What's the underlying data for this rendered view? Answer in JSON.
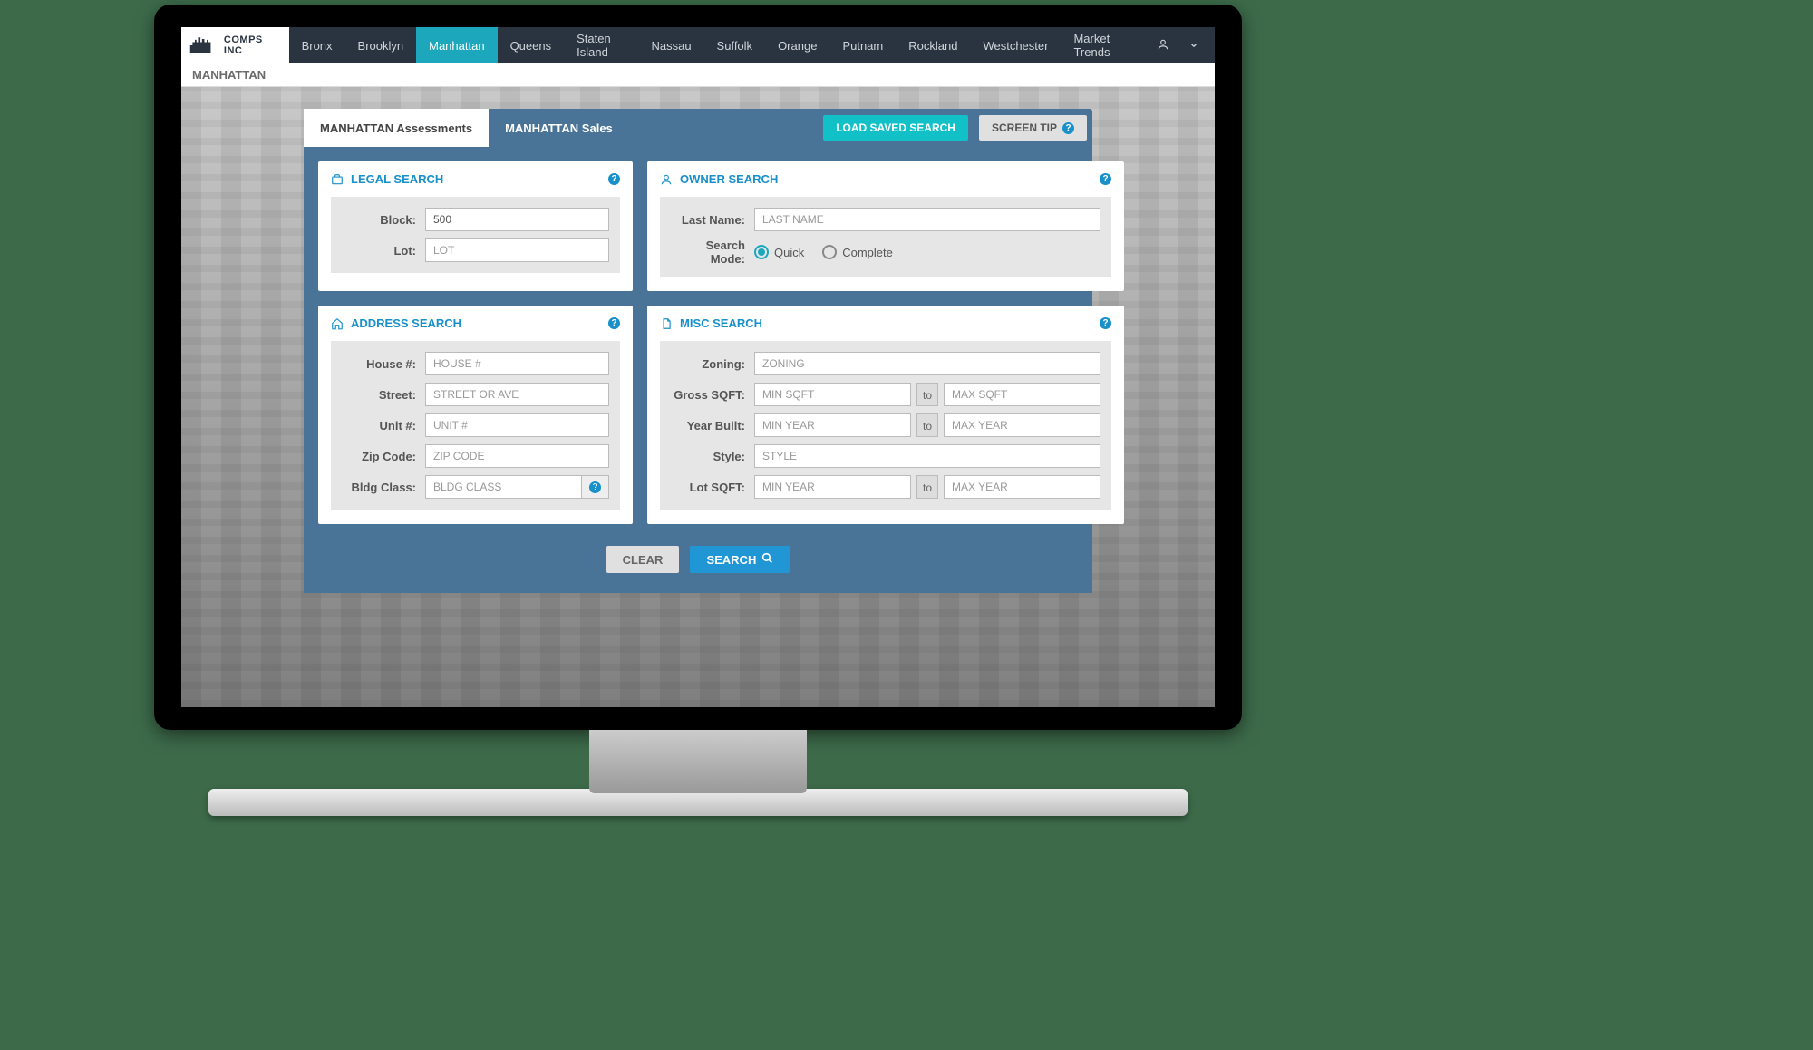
{
  "logo": "COMPS INC",
  "nav": [
    "Bronx",
    "Brooklyn",
    "Manhattan",
    "Queens",
    "Staten Island",
    "Nassau",
    "Suffolk",
    "Orange",
    "Putnam",
    "Rockland",
    "Westchester",
    "Market Trends"
  ],
  "nav_active_index": 2,
  "breadcrumb": "MANHATTAN",
  "tabs": {
    "assessments": "MANHATTAN Assessments",
    "sales": "MANHATTAN Sales"
  },
  "tab_buttons": {
    "load_saved": "LOAD SAVED SEARCH",
    "screen_tip": "SCREEN TIP"
  },
  "panels": {
    "legal": {
      "title": "LEGAL SEARCH",
      "block_label": "Block:",
      "block_value": "500",
      "lot_label": "Lot:",
      "lot_placeholder": "LOT"
    },
    "owner": {
      "title": "OWNER SEARCH",
      "lastname_label": "Last Name:",
      "lastname_placeholder": "LAST NAME",
      "mode_label": "Search Mode:",
      "mode_quick": "Quick",
      "mode_complete": "Complete"
    },
    "address": {
      "title": "ADDRESS SEARCH",
      "house_label": "House #:",
      "house_placeholder": "HOUSE #",
      "street_label": "Street:",
      "street_placeholder": "STREET OR AVE",
      "unit_label": "Unit #:",
      "unit_placeholder": "UNIT #",
      "zip_label": "Zip Code:",
      "zip_placeholder": "ZIP CODE",
      "bldg_label": "Bldg Class:",
      "bldg_placeholder": "BLDG CLASS"
    },
    "misc": {
      "title": "MISC SEARCH",
      "zoning_label": "Zoning:",
      "zoning_placeholder": "ZONING",
      "gross_label": "Gross SQFT:",
      "gross_min": "MIN SQFT",
      "gross_max": "MAX SQFT",
      "year_label": "Year Built:",
      "year_min": "MIN YEAR",
      "year_max": "MAX YEAR",
      "style_label": "Style:",
      "style_placeholder": "STYLE",
      "lot_label": "Lot SQFT:",
      "lot_min": "MIN YEAR",
      "lot_max": "MAX YEAR",
      "to": "to"
    }
  },
  "actions": {
    "clear": "CLEAR",
    "search": "SEARCH"
  }
}
